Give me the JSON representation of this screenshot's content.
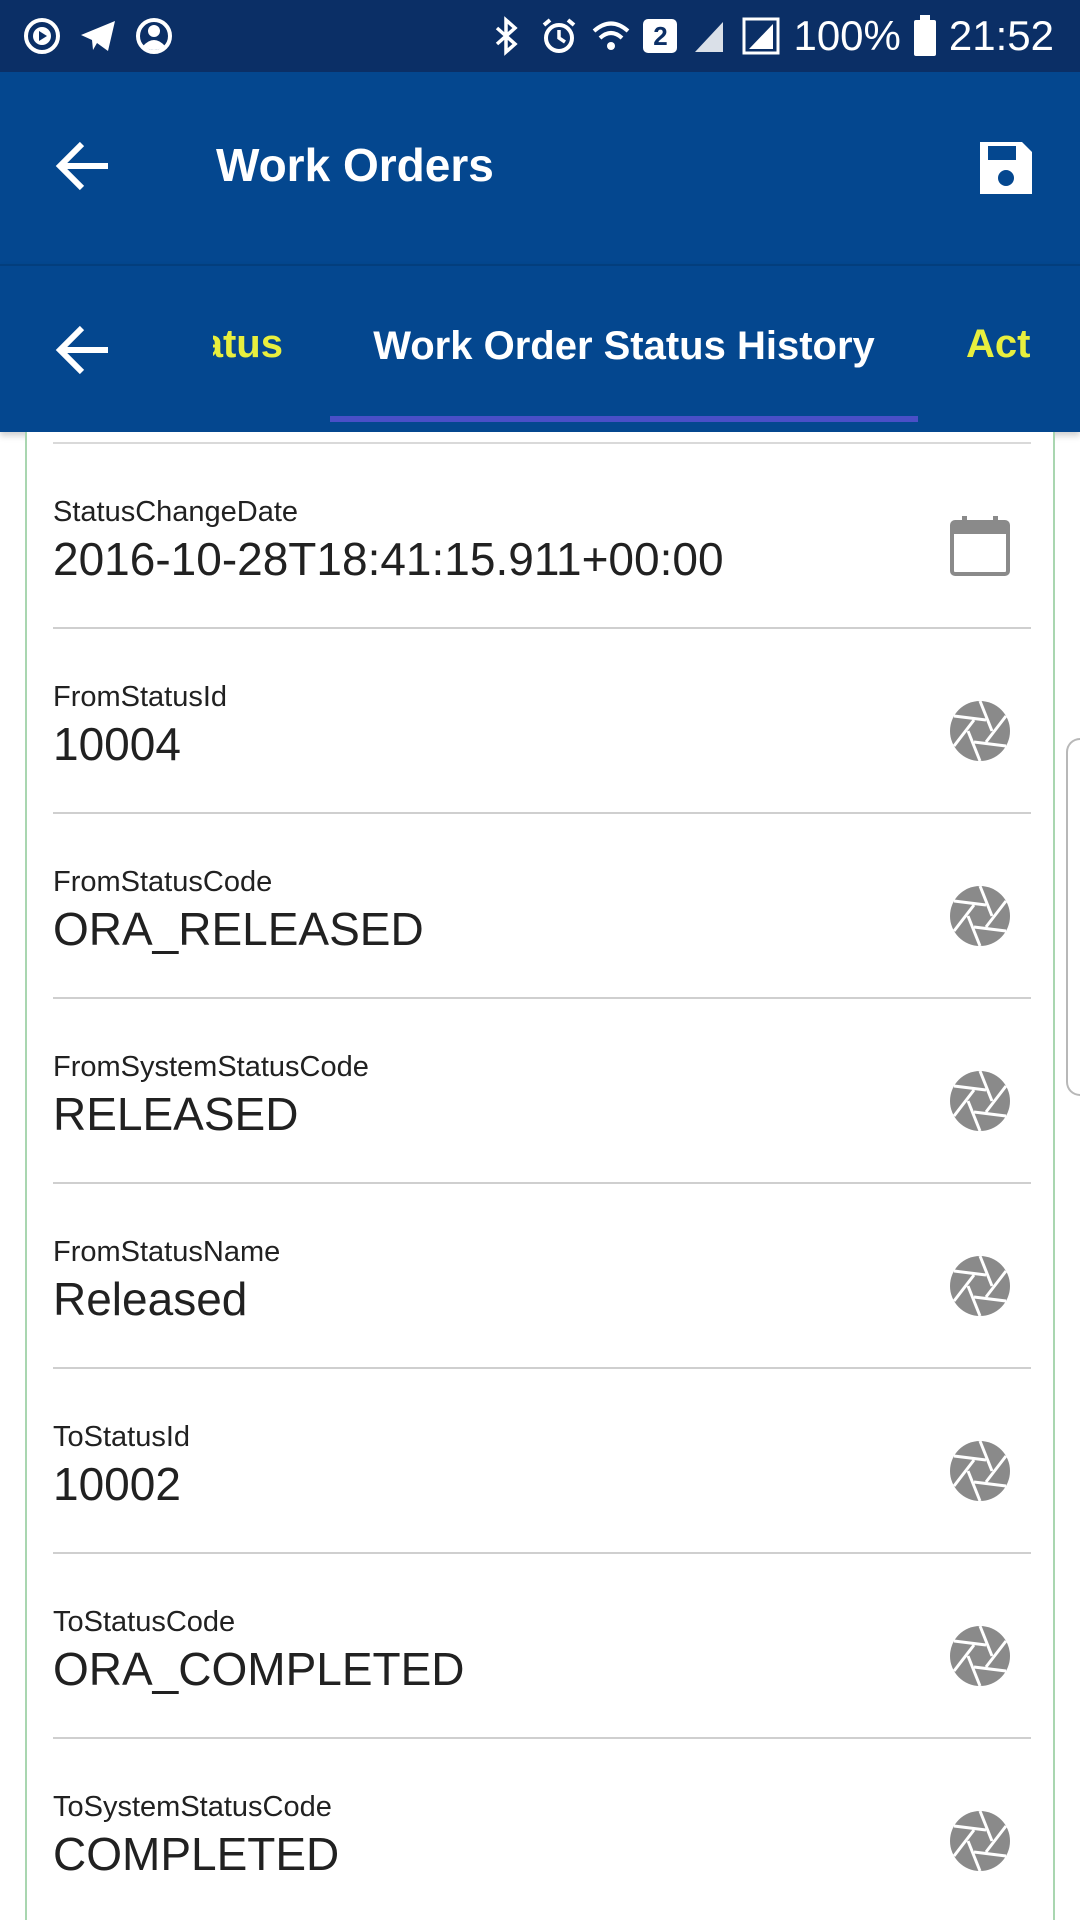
{
  "status_bar": {
    "battery": "100%",
    "time": "21:52",
    "sim_badge": "2",
    "icons_left": [
      "media-play-icon",
      "telegram-icon",
      "account-icon"
    ],
    "icons_right": [
      "bluetooth-icon",
      "alarm-icon",
      "wifi-icon",
      "signal-icon",
      "signal-icon",
      "battery-icon"
    ]
  },
  "appbar": {
    "title": "Work Orders"
  },
  "tabs": {
    "previous": "Work Order Status",
    "active": "Work Order Status History",
    "next": "Act"
  },
  "fields": [
    {
      "label": "StatusChangeDate",
      "value": "2016-10-28T18:41:15.911+00:00",
      "icon": "calendar-icon"
    },
    {
      "label": "FromStatusId",
      "value": "10004",
      "icon": "aperture-icon"
    },
    {
      "label": "FromStatusCode",
      "value": "ORA_RELEASED",
      "icon": "aperture-icon"
    },
    {
      "label": "FromSystemStatusCode",
      "value": "RELEASED",
      "icon": "aperture-icon"
    },
    {
      "label": "FromStatusName",
      "value": "Released",
      "icon": "aperture-icon"
    },
    {
      "label": "ToStatusId",
      "value": "10002",
      "icon": "aperture-icon"
    },
    {
      "label": "ToStatusCode",
      "value": "ORA_COMPLETED",
      "icon": "aperture-icon"
    },
    {
      "label": "ToSystemStatusCode",
      "value": "COMPLETED",
      "icon": "aperture-icon"
    }
  ],
  "colors": {
    "status_bar": "#0b2f66",
    "app_bar": "#04478f",
    "tab_inactive": "#e8ef3e",
    "tab_indicator": "#4a4fc7"
  }
}
